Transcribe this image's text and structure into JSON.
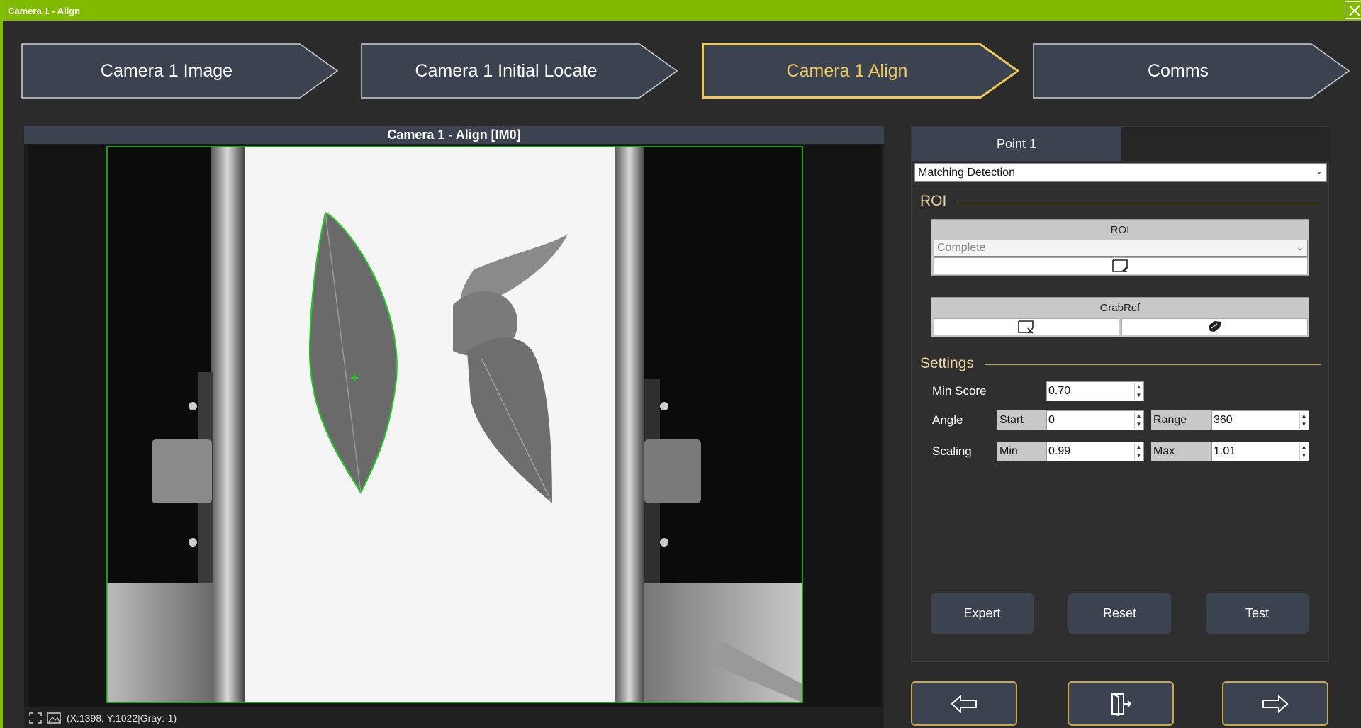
{
  "window": {
    "title": "Camera 1 - Align"
  },
  "steps": [
    {
      "label": "Camera 1 Image",
      "active": false
    },
    {
      "label": "Camera 1 Initial Locate",
      "active": false
    },
    {
      "label": "Camera 1 Align",
      "active": true
    },
    {
      "label": "Comms",
      "active": false
    }
  ],
  "viewer": {
    "title": "Camera 1 - Align  [IM0]",
    "status": "(X:1398, Y:1022|Gray:-1)"
  },
  "panel": {
    "tab": "Point 1",
    "method": "Matching Detection",
    "roi_section": "ROI",
    "roi_group": {
      "title": "ROI",
      "mode": "Complete"
    },
    "grabref_group": {
      "title": "GrabRef"
    },
    "settings_section": "Settings",
    "min_score": {
      "label": "Min Score",
      "value": "0.70"
    },
    "angle": {
      "label": "Angle",
      "start_label": "Start",
      "start_value": "0",
      "range_label": "Range",
      "range_value": "360"
    },
    "scaling": {
      "label": "Scaling",
      "min_label": "Min",
      "min_value": "0.99",
      "max_label": "Max",
      "max_value": "1.01"
    },
    "buttons": {
      "expert": "Expert",
      "reset": "Reset",
      "test": "Test"
    }
  },
  "colors": {
    "titlebar": "#80bb00",
    "accent": "#f0c85a",
    "button": "#3b4250",
    "detection": "#22cc22"
  },
  "icons": {
    "close": "close-icon",
    "roi_edit": "roi-edit-icon",
    "grabref_capture": "capture-icon",
    "grabref_clear": "eraser-icon",
    "prev": "arrow-left-icon",
    "exit": "exit-door-icon",
    "next": "arrow-right-icon"
  }
}
